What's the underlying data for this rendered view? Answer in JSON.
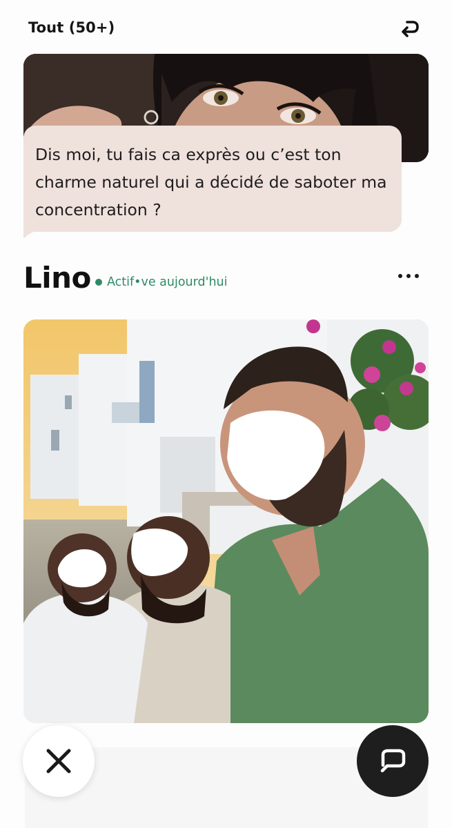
{
  "header": {
    "filter_label": "Tout (50+)",
    "back_icon": "undo-arrow-icon"
  },
  "previous_profile": {
    "photo": "woman-portrait-photo",
    "message": "Dis moi, tu fais ca exprès ou c’est ton charme naturel qui a décidé de saboter ma concentration ?"
  },
  "profile": {
    "name": "Lino",
    "status": "Actif•ve aujourd'hui",
    "status_color": "#2e8a66",
    "more_icon": "more-dots-icon",
    "photo": "group-photo-seaside"
  },
  "actions": {
    "pass_icon": "close-x-icon",
    "chat_icon": "chat-bubble-icon"
  }
}
